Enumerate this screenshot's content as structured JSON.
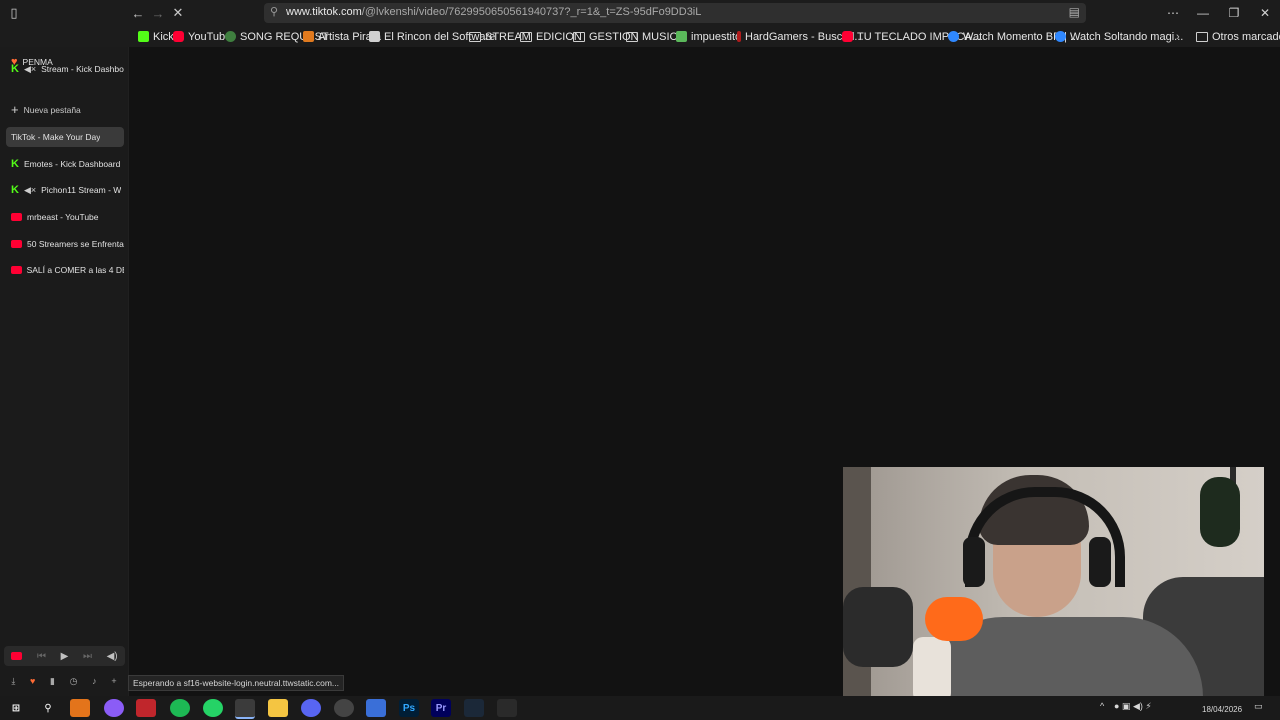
{
  "browser": {
    "url_domain": "www.tiktok.com",
    "url_path": "/@lvkenshi/video/7629950650561940737?_r=1&_t=ZS-95dFo9DD3iL"
  },
  "bookmarks": [
    {
      "label": "Kick",
      "icon": "kick-icon"
    },
    {
      "label": "YouTube",
      "icon": "youtube-icon"
    },
    {
      "label": "SONG REQUEST",
      "icon": "song-request-icon"
    },
    {
      "label": "Artista Pirata",
      "icon": "artista-pirata-icon"
    },
    {
      "label": "El Rincon del Software",
      "icon": "document-icon"
    },
    {
      "label": "STREAM",
      "icon": "folder-icon"
    },
    {
      "label": "EDICION",
      "icon": "folder-icon"
    },
    {
      "label": "GESTION",
      "icon": "folder-icon"
    },
    {
      "label": "MUSICA",
      "icon": "folder-icon"
    },
    {
      "label": "impuestito",
      "icon": "impuestito-icon"
    },
    {
      "label": "HardGamers - Buscad...",
      "icon": "hardgamers-icon"
    },
    {
      "label": "TU TECLADO IMPECA...",
      "icon": "youtube-icon"
    },
    {
      "label": "Watch Momento BR | ...",
      "icon": "go-icon"
    },
    {
      "label": "Watch Soltando magi...",
      "icon": "go-icon"
    },
    {
      "label": "Otros marcadores",
      "icon": "folder-icon"
    }
  ],
  "sidebar": {
    "group_label": "PENMA",
    "pinned": "Stream - Kick Dashboa",
    "new_tab": "Nueva pestaña",
    "tabs": [
      "TikTok - Make Your Day",
      "Emotes - Kick Dashboard",
      "Pichon11 Stream - W",
      "mrbeast - YouTube",
      "50 Streamers se Enfrenta",
      "SALÍ a COMER a las 4 DE"
    ]
  },
  "status_text": "Esperando a sf16-website-login.neutral.ttwstatic.com...",
  "taskbar": {
    "time": "",
    "date": "18/04/2026"
  }
}
